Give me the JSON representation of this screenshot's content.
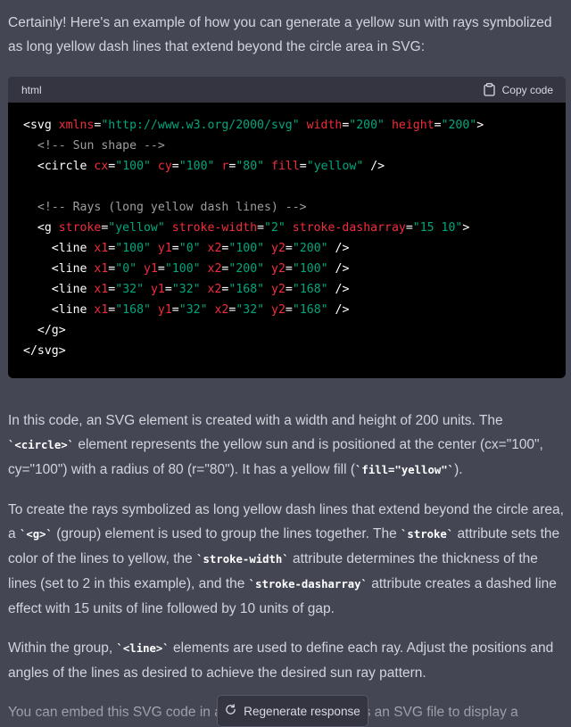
{
  "intro": {
    "text": "Certainly! Here's an example of how you can generate a yellow sun with rays symbolized as long yellow dash lines that extend beyond the circle area in SVG:"
  },
  "code_block": {
    "language": "html",
    "copy_label": "Copy code",
    "copy_icon": "clipboard-icon",
    "lines": [
      [
        {
          "t": "tag",
          "v": "<svg "
        },
        {
          "t": "attr",
          "v": "xmlns"
        },
        {
          "t": "eq",
          "v": "="
        },
        {
          "t": "str",
          "v": "\"http://www.w3.org/2000/svg\""
        },
        {
          "t": "tag",
          "v": " "
        },
        {
          "t": "attr",
          "v": "width"
        },
        {
          "t": "eq",
          "v": "="
        },
        {
          "t": "str",
          "v": "\"200\""
        },
        {
          "t": "tag",
          "v": " "
        },
        {
          "t": "attr",
          "v": "height"
        },
        {
          "t": "eq",
          "v": "="
        },
        {
          "t": "str",
          "v": "\"200\""
        },
        {
          "t": "tag",
          "v": ">"
        }
      ],
      [
        {
          "t": "tag",
          "v": "  "
        },
        {
          "t": "com",
          "v": "<!-- Sun shape -->"
        }
      ],
      [
        {
          "t": "tag",
          "v": "  <circle "
        },
        {
          "t": "attr",
          "v": "cx"
        },
        {
          "t": "eq",
          "v": "="
        },
        {
          "t": "str",
          "v": "\"100\""
        },
        {
          "t": "tag",
          "v": " "
        },
        {
          "t": "attr",
          "v": "cy"
        },
        {
          "t": "eq",
          "v": "="
        },
        {
          "t": "str",
          "v": "\"100\""
        },
        {
          "t": "tag",
          "v": " "
        },
        {
          "t": "attr",
          "v": "r"
        },
        {
          "t": "eq",
          "v": "="
        },
        {
          "t": "str",
          "v": "\"80\""
        },
        {
          "t": "tag",
          "v": " "
        },
        {
          "t": "attr",
          "v": "fill"
        },
        {
          "t": "eq",
          "v": "="
        },
        {
          "t": "str",
          "v": "\"yellow\""
        },
        {
          "t": "tag",
          "v": " />"
        }
      ],
      [
        {
          "t": "tag",
          "v": " "
        }
      ],
      [
        {
          "t": "tag",
          "v": "  "
        },
        {
          "t": "com",
          "v": "<!-- Rays (long yellow dash lines) -->"
        }
      ],
      [
        {
          "t": "tag",
          "v": "  <g "
        },
        {
          "t": "attr",
          "v": "stroke"
        },
        {
          "t": "eq",
          "v": "="
        },
        {
          "t": "str",
          "v": "\"yellow\""
        },
        {
          "t": "tag",
          "v": " "
        },
        {
          "t": "attr",
          "v": "stroke-width"
        },
        {
          "t": "eq",
          "v": "="
        },
        {
          "t": "str",
          "v": "\"2\""
        },
        {
          "t": "tag",
          "v": " "
        },
        {
          "t": "attr",
          "v": "stroke-dasharray"
        },
        {
          "t": "eq",
          "v": "="
        },
        {
          "t": "str",
          "v": "\"15 10\""
        },
        {
          "t": "tag",
          "v": ">"
        }
      ],
      [
        {
          "t": "tag",
          "v": "    <line "
        },
        {
          "t": "attr",
          "v": "x1"
        },
        {
          "t": "eq",
          "v": "="
        },
        {
          "t": "str",
          "v": "\"100\""
        },
        {
          "t": "tag",
          "v": " "
        },
        {
          "t": "attr",
          "v": "y1"
        },
        {
          "t": "eq",
          "v": "="
        },
        {
          "t": "str",
          "v": "\"0\""
        },
        {
          "t": "tag",
          "v": " "
        },
        {
          "t": "attr",
          "v": "x2"
        },
        {
          "t": "eq",
          "v": "="
        },
        {
          "t": "str",
          "v": "\"100\""
        },
        {
          "t": "tag",
          "v": " "
        },
        {
          "t": "attr",
          "v": "y2"
        },
        {
          "t": "eq",
          "v": "="
        },
        {
          "t": "str",
          "v": "\"200\""
        },
        {
          "t": "tag",
          "v": " />"
        }
      ],
      [
        {
          "t": "tag",
          "v": "    <line "
        },
        {
          "t": "attr",
          "v": "x1"
        },
        {
          "t": "eq",
          "v": "="
        },
        {
          "t": "str",
          "v": "\"0\""
        },
        {
          "t": "tag",
          "v": " "
        },
        {
          "t": "attr",
          "v": "y1"
        },
        {
          "t": "eq",
          "v": "="
        },
        {
          "t": "str",
          "v": "\"100\""
        },
        {
          "t": "tag",
          "v": " "
        },
        {
          "t": "attr",
          "v": "x2"
        },
        {
          "t": "eq",
          "v": "="
        },
        {
          "t": "str",
          "v": "\"200\""
        },
        {
          "t": "tag",
          "v": " "
        },
        {
          "t": "attr",
          "v": "y2"
        },
        {
          "t": "eq",
          "v": "="
        },
        {
          "t": "str",
          "v": "\"100\""
        },
        {
          "t": "tag",
          "v": " />"
        }
      ],
      [
        {
          "t": "tag",
          "v": "    <line "
        },
        {
          "t": "attr",
          "v": "x1"
        },
        {
          "t": "eq",
          "v": "="
        },
        {
          "t": "str",
          "v": "\"32\""
        },
        {
          "t": "tag",
          "v": " "
        },
        {
          "t": "attr",
          "v": "y1"
        },
        {
          "t": "eq",
          "v": "="
        },
        {
          "t": "str",
          "v": "\"32\""
        },
        {
          "t": "tag",
          "v": " "
        },
        {
          "t": "attr",
          "v": "x2"
        },
        {
          "t": "eq",
          "v": "="
        },
        {
          "t": "str",
          "v": "\"168\""
        },
        {
          "t": "tag",
          "v": " "
        },
        {
          "t": "attr",
          "v": "y2"
        },
        {
          "t": "eq",
          "v": "="
        },
        {
          "t": "str",
          "v": "\"168\""
        },
        {
          "t": "tag",
          "v": " />"
        }
      ],
      [
        {
          "t": "tag",
          "v": "    <line "
        },
        {
          "t": "attr",
          "v": "x1"
        },
        {
          "t": "eq",
          "v": "="
        },
        {
          "t": "str",
          "v": "\"168\""
        },
        {
          "t": "tag",
          "v": " "
        },
        {
          "t": "attr",
          "v": "y1"
        },
        {
          "t": "eq",
          "v": "="
        },
        {
          "t": "str",
          "v": "\"32\""
        },
        {
          "t": "tag",
          "v": " "
        },
        {
          "t": "attr",
          "v": "x2"
        },
        {
          "t": "eq",
          "v": "="
        },
        {
          "t": "str",
          "v": "\"32\""
        },
        {
          "t": "tag",
          "v": " "
        },
        {
          "t": "attr",
          "v": "y2"
        },
        {
          "t": "eq",
          "v": "="
        },
        {
          "t": "str",
          "v": "\"168\""
        },
        {
          "t": "tag",
          "v": " />"
        }
      ],
      [
        {
          "t": "tag",
          "v": "  </g>"
        }
      ],
      [
        {
          "t": "tag",
          "v": "</svg>"
        }
      ]
    ]
  },
  "explanation": [
    [
      {
        "t": "text",
        "v": "In this code, an SVG element is created with a width and height of 200 units. The "
      },
      {
        "t": "code",
        "v": "`<circle>`"
      },
      {
        "t": "text",
        "v": " element represents the yellow sun and is positioned at the center (cx=\"100\", cy=\"100\") with a radius of 80 (r=\"80\"). It has a yellow fill ("
      },
      {
        "t": "code",
        "v": "`fill=\"yellow\"`"
      },
      {
        "t": "text",
        "v": ")."
      }
    ],
    [
      {
        "t": "text",
        "v": "To create the rays symbolized as long yellow dash lines that extend beyond the circle area, a "
      },
      {
        "t": "code",
        "v": "`<g>`"
      },
      {
        "t": "text",
        "v": " (group) element is used to group the lines together. The "
      },
      {
        "t": "code",
        "v": "`stroke`"
      },
      {
        "t": "text",
        "v": " attribute sets the color of the lines to yellow, the "
      },
      {
        "t": "code",
        "v": "`stroke-width`"
      },
      {
        "t": "text",
        "v": " attribute determines the thickness of the lines (set to 2 in this example), and the "
      },
      {
        "t": "code",
        "v": "`stroke-dasharray`"
      },
      {
        "t": "text",
        "v": " attribute creates a dashed line effect with 15 units of line followed by 10 units of gap."
      }
    ],
    [
      {
        "t": "text",
        "v": "Within the group, "
      },
      {
        "t": "code",
        "v": "`<line>`"
      },
      {
        "t": "text",
        "v": " elements are used to define each ray. Adjust the positions and angles of the lines as desired to achieve the desired sun ray pattern."
      }
    ],
    [
      {
        "t": "text",
        "v": "You can embed this SVG code in an HTML file or save it as an SVG file to display a"
      }
    ]
  ],
  "regenerate": {
    "label": "Regenerate response",
    "icon": "refresh-icon"
  },
  "colors": {
    "background": "#444654",
    "code_background": "#000000",
    "code_header": "#343541",
    "attr": "#f22c3d",
    "string": "#00a67d",
    "comment": "#9e9e9e",
    "text": "#d1d5db"
  }
}
